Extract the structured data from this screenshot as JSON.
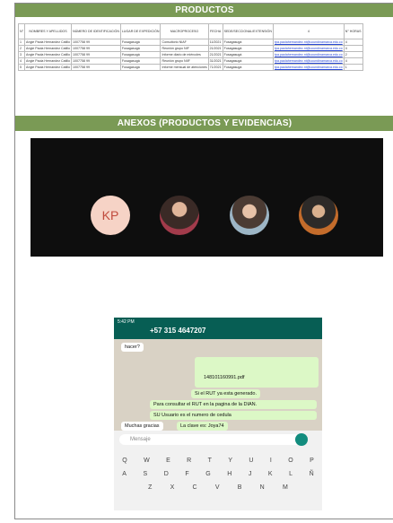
{
  "sections": {
    "products_title": "PRODUCTOS",
    "annexes_title": "ANEXOS (PRODUCTOS Y EVIDENCIAS)"
  },
  "table": {
    "headers": [
      "N°",
      "NOMBRES Y APELLIDOS",
      "NÚMERO DE IDENTIFICACIÓN",
      "LUGAR DE EXPEDICIÓN",
      "MACROPROCESO",
      "FECHA",
      "SEDE/SECCIONAL/EXTENSIÓN",
      "4",
      "N° HORAS"
    ],
    "rows": [
      [
        "1",
        "Angie Paola Hernandez Catillo",
        "1007758 99",
        "Fusagasugá",
        "Consultorio NIAF",
        "11/2021",
        "Fusagasugá",
        "tpa.paolahernandez.nt@ucundinamarca.edu.co",
        "4"
      ],
      [
        "2",
        "Angie Paola Hernandez Catillo",
        "1007758 99",
        "Fusagasugá",
        "Reunión grupo NIF",
        "21/2021",
        "Fusagasugá",
        "tpa.paolahernandez.nt@ucundinamarca.edu.co",
        "4"
      ],
      [
        "3",
        "Angie Paola Hernandez Catillo",
        "1007758 99",
        "Fusagasugá",
        "Informe diario de miércoles",
        "21/2021",
        "Fusagasugá",
        "tpa.paolahernandez.nt@ucundinamarca.edu.co",
        "2"
      ],
      [
        "4",
        "Angie Paola Hernandez Catillo",
        "1007758 99",
        "Fusagasugá",
        "Reunión grupo NIIF",
        "31/2021",
        "Fusagasugá",
        "tpa.paolahernandez.nt@ucundinamarca.edu.co",
        "4"
      ],
      [
        "5",
        "Angie Paola Hernandez Catillo",
        "1007758 99",
        "Fusagasugá",
        "Informe mensual de atenciones",
        "71/2021",
        "Fusagasugá",
        "tpa.paolahernandez.nt@ucundinamarca.edu.co",
        "1"
      ]
    ]
  },
  "meeting": {
    "initials": "KP"
  },
  "whatsapp": {
    "time": "5:42 PM",
    "phone": "+57 315 4647207",
    "msg1": "hacer?",
    "file": "148101160991.pdf",
    "msg2": "Si el RUT ya esta generado.",
    "msg3": "Para consultar el RUT en la pagina de la DIAN.",
    "msg4": "SU Usuario es el numero de cedula",
    "msg5": "La clave es: Joya74",
    "msg6": "Muchas gracias",
    "input_placeholder": "Mensaje",
    "keys_row1": [
      "Q",
      "W",
      "E",
      "R",
      "T",
      "Y",
      "U",
      "I",
      "O",
      "P"
    ],
    "keys_row2": [
      "A",
      "S",
      "D",
      "F",
      "G",
      "H",
      "J",
      "K",
      "L",
      "Ñ"
    ],
    "keys_row3": [
      "Z",
      "X",
      "C",
      "V",
      "B",
      "N",
      "M"
    ]
  }
}
